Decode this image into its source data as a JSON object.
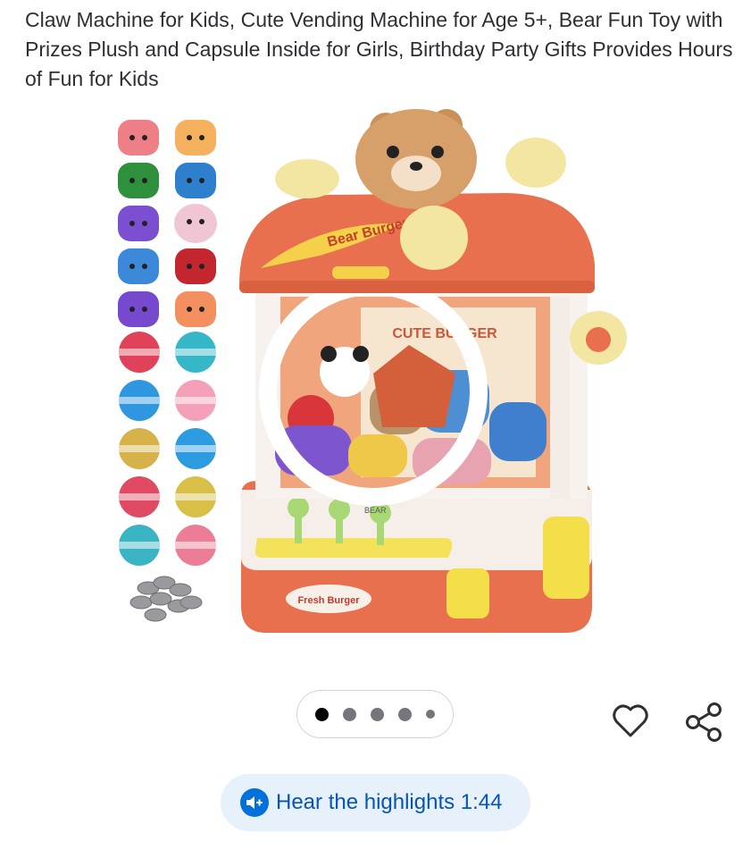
{
  "product": {
    "title": "Claw Machine for Kids, Cute Vending Machine for Age 5+, Bear Fun Toy with Prizes Plush and Capsule Inside for Girls, Birthday Party Gifts Provides Hours of Fun for Kids",
    "image_alt": "Claw Machine for Kids product image",
    "image_signs": {
      "main_sign": "Bear Burger",
      "base_label": "Fresh Burger",
      "inner_sign": "CUTE BURGER",
      "panel_text": "BEAR"
    }
  },
  "gallery": {
    "image_count": 5,
    "active_index": 0
  },
  "actions": {
    "favorite_icon": "heart-outline-icon",
    "share_icon": "share-icon"
  },
  "highlights": {
    "label": "Hear the highlights 1:44",
    "icon": "audio-play-icon"
  },
  "colors": {
    "link_blue": "#0654ba",
    "pill_bg": "#e6f1fc",
    "machine_orange": "#e8704f"
  }
}
